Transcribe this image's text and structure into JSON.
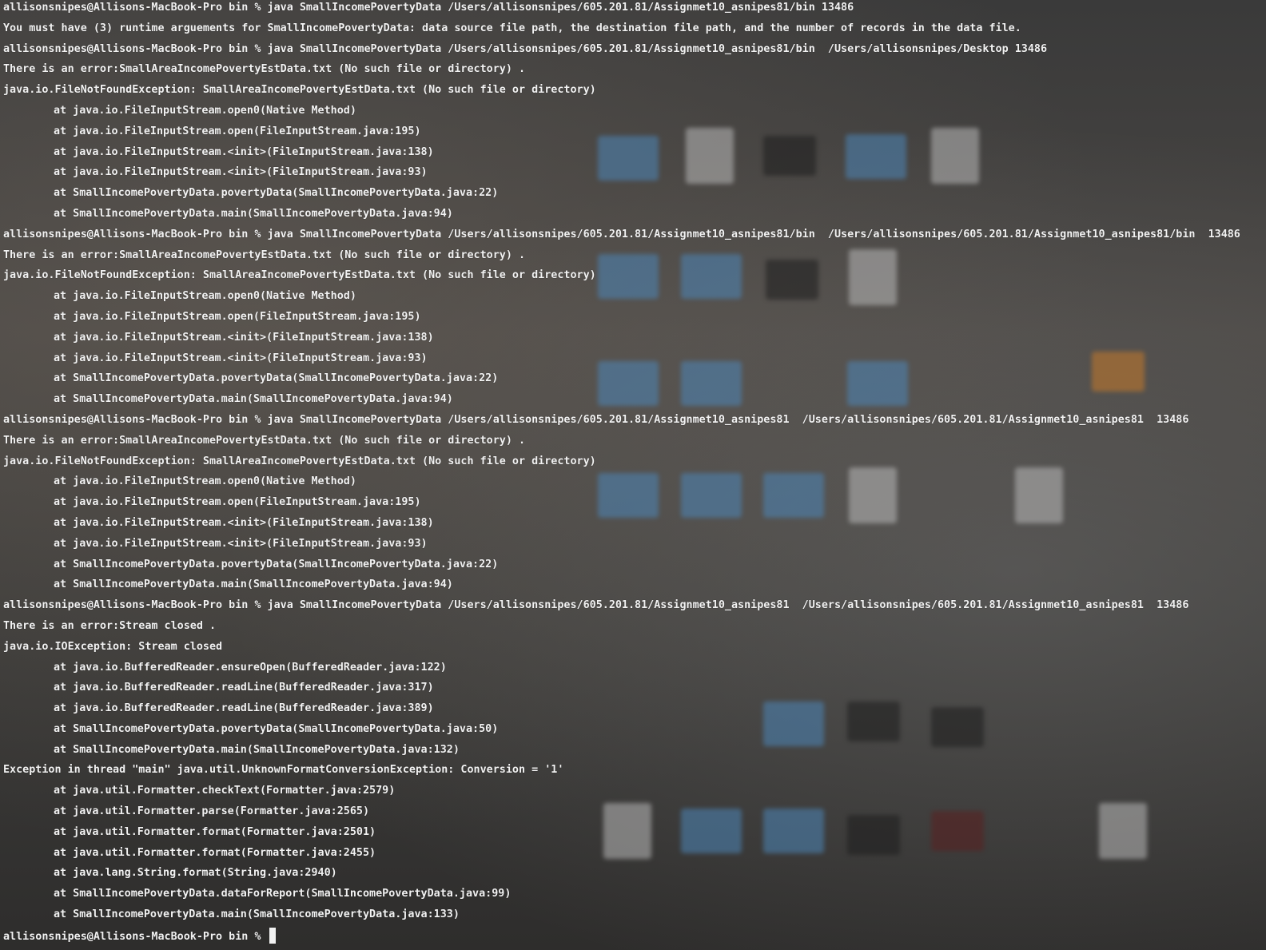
{
  "terminal": {
    "lines": [
      "allisonsnipes@Allisons-MacBook-Pro bin % java SmallIncomePovertyData /Users/allisonsnipes/605.201.81/Assignmet10_asnipes81/bin 13486",
      "You must have (3) runtime arguements for SmallIncomePovertyData: data source file path, the destination file path, and the number of records in the data file.",
      "allisonsnipes@Allisons-MacBook-Pro bin % java SmallIncomePovertyData /Users/allisonsnipes/605.201.81/Assignmet10_asnipes81/bin  /Users/allisonsnipes/Desktop 13486",
      "There is an error:SmallAreaIncomePovertyEstData.txt (No such file or directory) .",
      "java.io.FileNotFoundException: SmallAreaIncomePovertyEstData.txt (No such file or directory)",
      "at java.io.FileInputStream.open0(Native Method)",
      "at java.io.FileInputStream.open(FileInputStream.java:195)",
      "at java.io.FileInputStream.<init>(FileInputStream.java:138)",
      "at java.io.FileInputStream.<init>(FileInputStream.java:93)",
      "at SmallIncomePovertyData.povertyData(SmallIncomePovertyData.java:22)",
      "at SmallIncomePovertyData.main(SmallIncomePovertyData.java:94)",
      "allisonsnipes@Allisons-MacBook-Pro bin % java SmallIncomePovertyData /Users/allisonsnipes/605.201.81/Assignmet10_asnipes81/bin  /Users/allisonsnipes/605.201.81/Assignmet10_asnipes81/bin  13486",
      "There is an error:SmallAreaIncomePovertyEstData.txt (No such file or directory) .",
      "java.io.FileNotFoundException: SmallAreaIncomePovertyEstData.txt (No such file or directory)",
      "at java.io.FileInputStream.open0(Native Method)",
      "at java.io.FileInputStream.open(FileInputStream.java:195)",
      "at java.io.FileInputStream.<init>(FileInputStream.java:138)",
      "at java.io.FileInputStream.<init>(FileInputStream.java:93)",
      "at SmallIncomePovertyData.povertyData(SmallIncomePovertyData.java:22)",
      "at SmallIncomePovertyData.main(SmallIncomePovertyData.java:94)",
      "allisonsnipes@Allisons-MacBook-Pro bin % java SmallIncomePovertyData /Users/allisonsnipes/605.201.81/Assignmet10_asnipes81  /Users/allisonsnipes/605.201.81/Assignmet10_asnipes81  13486",
      "There is an error:SmallAreaIncomePovertyEstData.txt (No such file or directory) .",
      "java.io.FileNotFoundException: SmallAreaIncomePovertyEstData.txt (No such file or directory)",
      "at java.io.FileInputStream.open0(Native Method)",
      "at java.io.FileInputStream.open(FileInputStream.java:195)",
      "at java.io.FileInputStream.<init>(FileInputStream.java:138)",
      "at java.io.FileInputStream.<init>(FileInputStream.java:93)",
      "at SmallIncomePovertyData.povertyData(SmallIncomePovertyData.java:22)",
      "at SmallIncomePovertyData.main(SmallIncomePovertyData.java:94)",
      "allisonsnipes@Allisons-MacBook-Pro bin % java SmallIncomePovertyData /Users/allisonsnipes/605.201.81/Assignmet10_asnipes81  /Users/allisonsnipes/605.201.81/Assignmet10_asnipes81  13486",
      "There is an error:Stream closed .",
      "java.io.IOException: Stream closed",
      "at java.io.BufferedReader.ensureOpen(BufferedReader.java:122)",
      "at java.io.BufferedReader.readLine(BufferedReader.java:317)",
      "at java.io.BufferedReader.readLine(BufferedReader.java:389)",
      "at SmallIncomePovertyData.povertyData(SmallIncomePovertyData.java:50)",
      "at SmallIncomePovertyData.main(SmallIncomePovertyData.java:132)",
      "Exception in thread \"main\" java.util.UnknownFormatConversionException: Conversion = '1'",
      "at java.util.Formatter.checkText(Formatter.java:2579)",
      "at java.util.Formatter.parse(Formatter.java:2565)",
      "at java.util.Formatter.format(Formatter.java:2501)",
      "at java.util.Formatter.format(Formatter.java:2455)",
      "at java.lang.String.format(String.java:2940)",
      "at SmallIncomePovertyData.dataForReport(SmallIncomePovertyData.java:99)",
      "at SmallIncomePovertyData.main(SmallIncomePovertyData.java:133)"
    ],
    "indented": [
      5,
      6,
      7,
      8,
      9,
      10,
      14,
      15,
      16,
      17,
      18,
      19,
      23,
      24,
      25,
      26,
      27,
      28,
      32,
      33,
      34,
      35,
      36,
      38,
      39,
      40,
      41,
      42,
      43,
      44
    ],
    "prompt": "allisonsnipes@Allisons-MacBook-Pro bin % "
  }
}
